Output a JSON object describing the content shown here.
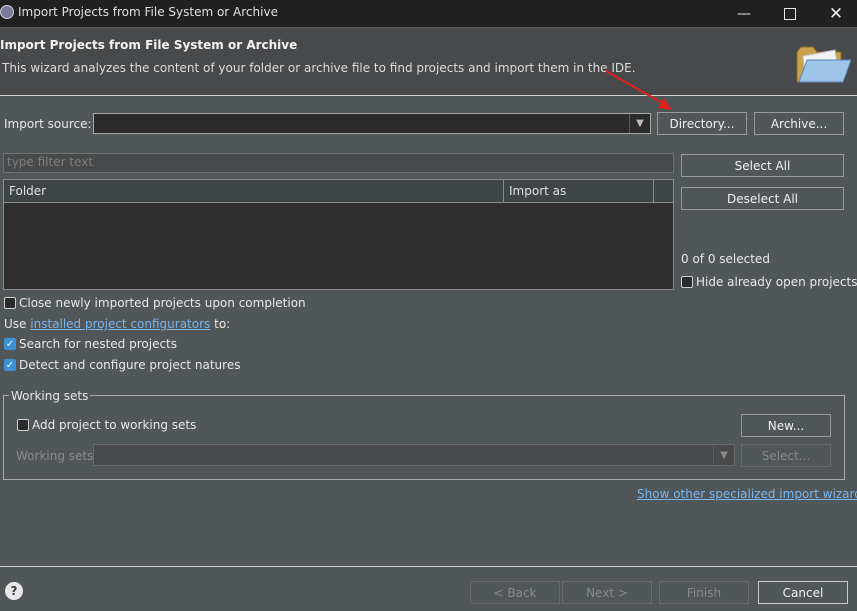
{
  "window": {
    "title": "Import Projects from File System or Archive"
  },
  "header": {
    "title": "Import Projects from File System or Archive",
    "description": "This wizard analyzes the content of your folder or archive file to find projects and import them in the IDE."
  },
  "import_source": {
    "label": "Import source:",
    "value": "",
    "directory_button": "Directory...",
    "archive_button": "Archive..."
  },
  "filter": {
    "placeholder": "type filter text"
  },
  "table": {
    "columns": [
      "Folder",
      "Import as"
    ],
    "rows": []
  },
  "selection": {
    "select_all": "Select All",
    "deselect_all": "Deselect All",
    "count_text": "0 of 0 selected",
    "hide_open_label": "Hide already open projects",
    "hide_open_checked": false
  },
  "options": {
    "close_after_label": "Close newly imported projects upon completion",
    "close_after_checked": false,
    "use_prefix": "Use",
    "configurators_link": "installed project configurators",
    "use_suffix": "to:",
    "search_nested_label": "Search for nested projects",
    "search_nested_checked": true,
    "detect_natures_label": "Detect and configure project natures",
    "detect_natures_checked": true
  },
  "working_sets": {
    "group_title": "Working sets",
    "add_label": "Add project to working sets",
    "add_checked": false,
    "new_button": "New...",
    "sets_label": "Working sets:",
    "sets_value": "",
    "select_button": "Select..."
  },
  "specialized_link": "Show other specialized import wizards",
  "footer": {
    "back": "< Back",
    "next": "Next >",
    "finish": "Finish",
    "cancel": "Cancel"
  },
  "colors": {
    "background": "#515658",
    "titlebar": "#202020",
    "accent": "#3d8fd6",
    "link": "#78b6f0",
    "annotation_arrow": "#e0201c"
  }
}
